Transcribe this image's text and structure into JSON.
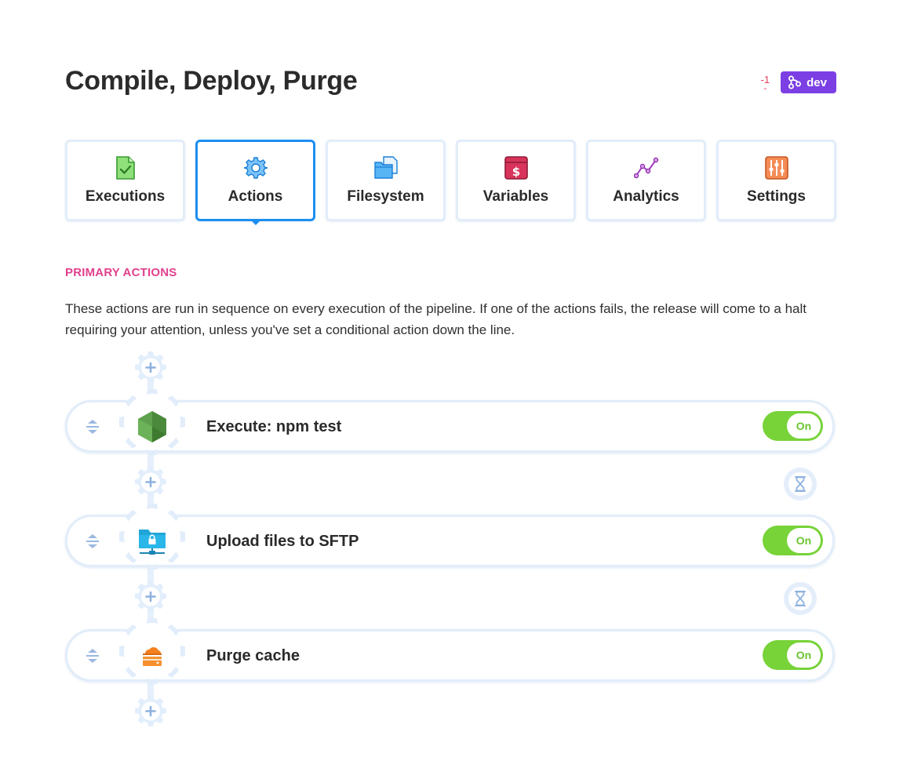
{
  "page": {
    "title": "Compile, Deploy, Purge"
  },
  "header": {
    "change_count": "-1",
    "change_dash": "-",
    "branch_label": "dev",
    "branch_icon": "git-branch-icon",
    "colors": {
      "branch_bg": "#7b3fe4",
      "change_count": "#e2405a"
    }
  },
  "tabs": [
    {
      "label": "Executions",
      "icon": "document-check-icon",
      "active": false
    },
    {
      "label": "Actions",
      "icon": "gear-icon",
      "active": true
    },
    {
      "label": "Filesystem",
      "icon": "folder-icon",
      "active": false
    },
    {
      "label": "Variables",
      "icon": "dollar-icon",
      "active": false
    },
    {
      "label": "Analytics",
      "icon": "line-chart-icon",
      "active": false
    },
    {
      "label": "Settings",
      "icon": "sliders-icon",
      "active": false
    }
  ],
  "section": {
    "label": "PRIMARY ACTIONS",
    "description": "These actions are run in sequence on every execution of the pipeline. If one of the actions fails, the release will come to a halt requiring your attention, unless you've set a conditional action down the line."
  },
  "actions": [
    {
      "name": "Execute: npm test",
      "icon": "nodejs-icon",
      "toggle_label": "On",
      "enabled": true
    },
    {
      "name": "Upload files to SFTP",
      "icon": "sftp-server-icon",
      "toggle_label": "On",
      "enabled": true
    },
    {
      "name": "Purge cache",
      "icon": "cloudflare-icon",
      "toggle_label": "On",
      "enabled": true
    }
  ],
  "colors": {
    "accent": "#1d8ff0",
    "section_label": "#e1408d",
    "toggle_on": "#77d338",
    "border": "#e2edf9"
  }
}
